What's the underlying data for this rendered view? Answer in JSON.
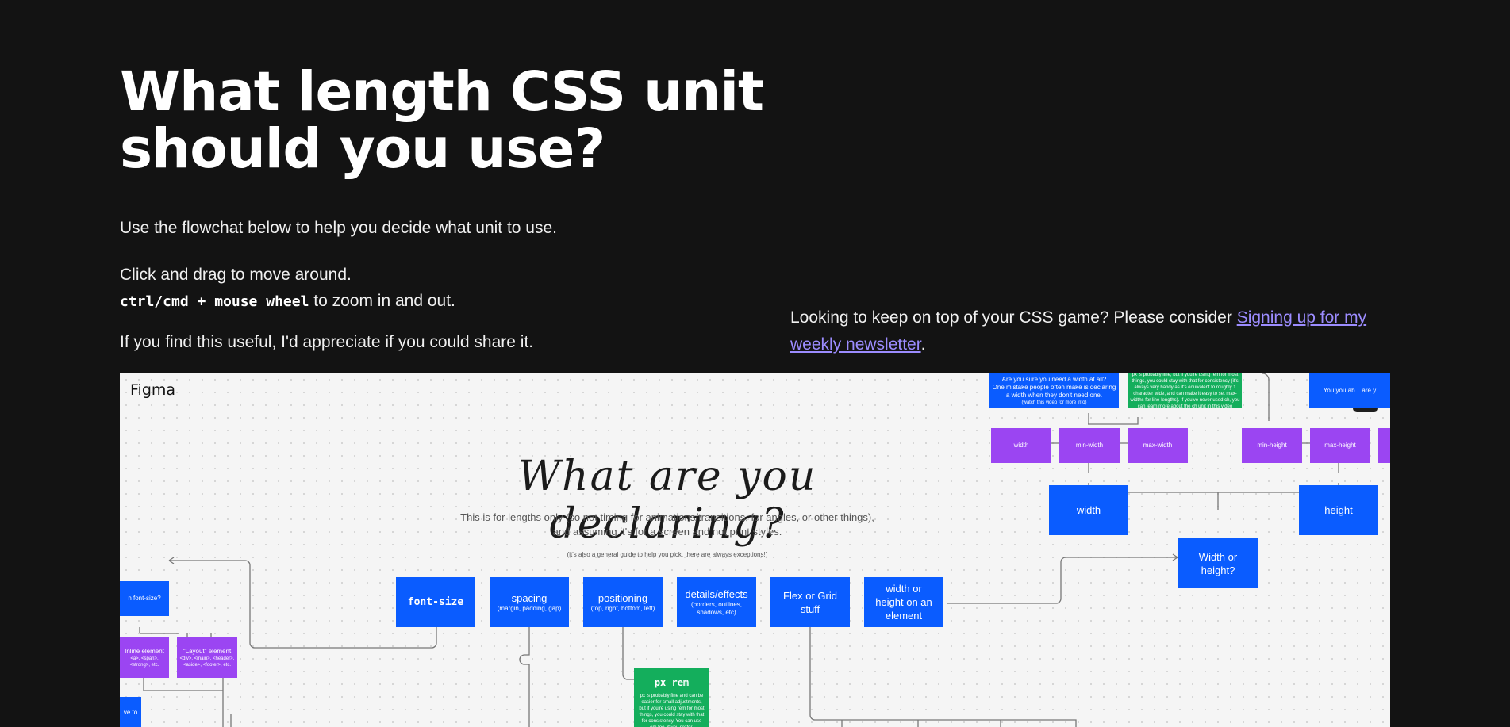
{
  "page": {
    "title": "What length CSS unit should you use?",
    "intro_line1": "Use the flowchat below to help you decide what unit to use.",
    "intro_line2": "Click and drag to move around.",
    "shortcut_code": "ctrl/cmd + mouse wheel",
    "shortcut_text": " to zoom in and out.",
    "intro_line3": "If you find this useful, I'd appreciate if you could share it.",
    "newsletter_text": "Looking to keep on top of your CSS game? Please consider ",
    "newsletter_link": "Signing up for my weekly newsletter",
    "newsletter_end": "."
  },
  "embed": {
    "brand": "Figma",
    "expand_icon": "expand-arrows-icon",
    "canvas": {
      "heading": "What are you declaring?",
      "subtitle_line1": "This is for lengths only (so not timing for animations/transitions, for angles, or other things),",
      "subtitle_line2": "and assuming it's for a screen and not print styles.",
      "note": "(it's also a general guide to help you pick, there are always exceptions!)",
      "choices": {
        "font_size": "font-size",
        "spacing": "spacing",
        "spacing_sub": "(margin, padding, gap)",
        "positioning": "positioning",
        "positioning_sub": "(top, right, bottom, left)",
        "details": "details/effects",
        "details_sub": "(borders, outlines, shadows, etc)",
        "flexgrid": "Flex or Grid stuff",
        "width_height": "width or height on an element"
      },
      "width_or_height": "Width or height?",
      "width": "width",
      "height": "height",
      "width_options": [
        "width",
        "min-width",
        "max-width"
      ],
      "height_options": [
        "min-height",
        "max-height"
      ],
      "width_question_line1": "Are you sure you need a width at all?",
      "width_question_line2": "One mistake people often make is declaring a width when they don't need one.",
      "width_question_line3": "(watch this video for more info)",
      "width_green_note": "px is probably fine, but if you're using rem for most things, you could stay with that for consistency (it's always very handy as it's equivalent to roughly 1 character wide, and can make it easy to set max-widths for line-lengths). If you've never used ch, you can learn more about the ch unit in this video",
      "right_question": "You you ab... are y",
      "left_question": "n font-size?",
      "inline_element": "Inline element",
      "inline_element_sub": "<a>, <span>, <strong>, etc.",
      "layout_element": "\"Layout\" element",
      "layout_element_sub": "<div>, <main>, <header>, <aside>, <footer>, etc.",
      "left_bottom": "ve to",
      "px_rem": "px rem",
      "px_rem_note": "px is probably fine and can be easier for small adjustments, but if you're using rem for most things, you could stay with that for consistency. You can use em too, if you prefer."
    }
  }
}
